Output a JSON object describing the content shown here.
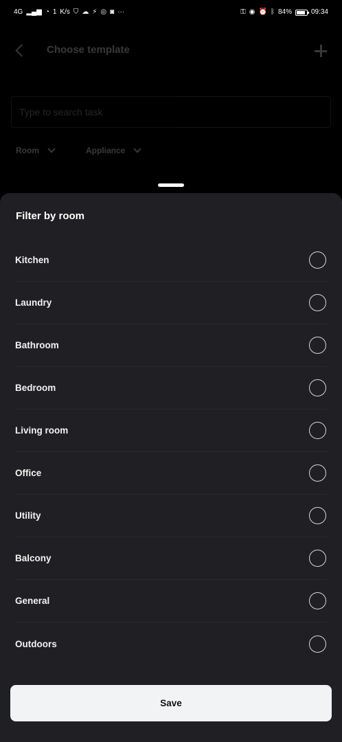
{
  "status_bar": {
    "network": "4G",
    "speed_value": "1",
    "speed_unit": "K/s",
    "battery": "84%",
    "battery_level": 0.84,
    "time": "09:34"
  },
  "header": {
    "title": "Choose template"
  },
  "search": {
    "placeholder": "Type to search task"
  },
  "filters": {
    "room_label": "Room",
    "appliance_label": "Appliance"
  },
  "sheet": {
    "title": "Filter by room",
    "rooms": [
      {
        "label": "Kitchen",
        "selected": false
      },
      {
        "label": "Laundry",
        "selected": false
      },
      {
        "label": "Bathroom",
        "selected": false
      },
      {
        "label": "Bedroom",
        "selected": false
      },
      {
        "label": "Living room",
        "selected": false
      },
      {
        "label": "Office",
        "selected": false
      },
      {
        "label": "Utility",
        "selected": false
      },
      {
        "label": "Balcony",
        "selected": false
      },
      {
        "label": "General",
        "selected": false
      },
      {
        "label": "Outdoors",
        "selected": false
      }
    ],
    "save_label": "Save"
  }
}
